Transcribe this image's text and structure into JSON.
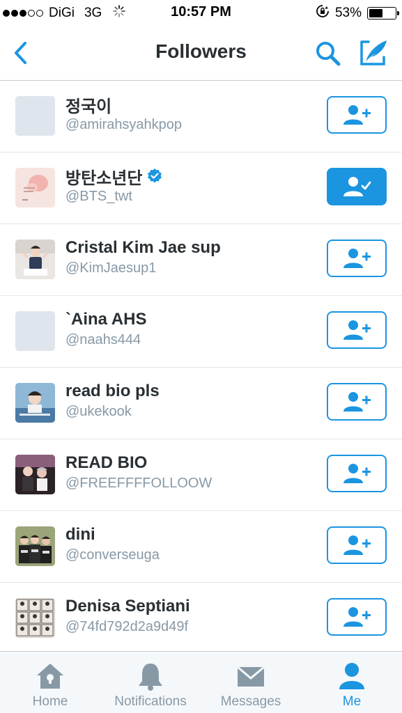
{
  "status_bar": {
    "carrier": "DiGi",
    "network": "3G",
    "time": "10:57 PM",
    "battery": "53%",
    "battery_level": 0.53
  },
  "nav": {
    "title": "Followers",
    "accent_color": "#1b95e0"
  },
  "followers": [
    {
      "name": "정국이",
      "handle": "@amirahsyahkpop",
      "verified": false,
      "following": false
    },
    {
      "name": "방탄소년단",
      "handle": "@BTS_twt",
      "verified": true,
      "following": true
    },
    {
      "name": "Cristal Kim Jae sup",
      "handle": "@KimJaesup1",
      "verified": false,
      "following": false
    },
    {
      "name": "`Aina AHS",
      "handle": "@naahs444",
      "verified": false,
      "following": false
    },
    {
      "name": "read bio pls",
      "handle": "@ukekook",
      "verified": false,
      "following": false
    },
    {
      "name": "READ BIO",
      "handle": "@FREEFFFFOLLOOW",
      "verified": false,
      "following": false
    },
    {
      "name": "dini",
      "handle": "@converseuga",
      "verified": false,
      "following": false
    },
    {
      "name": "Denisa Septiani",
      "handle": "@74fd792d2a9d49f",
      "verified": false,
      "following": false
    }
  ],
  "tabs": [
    {
      "label": "Home",
      "icon": "home-icon",
      "active": false
    },
    {
      "label": "Notifications",
      "icon": "bell-icon",
      "active": false
    },
    {
      "label": "Messages",
      "icon": "envelope-icon",
      "active": false
    },
    {
      "label": "Me",
      "icon": "person-icon",
      "active": true
    }
  ]
}
